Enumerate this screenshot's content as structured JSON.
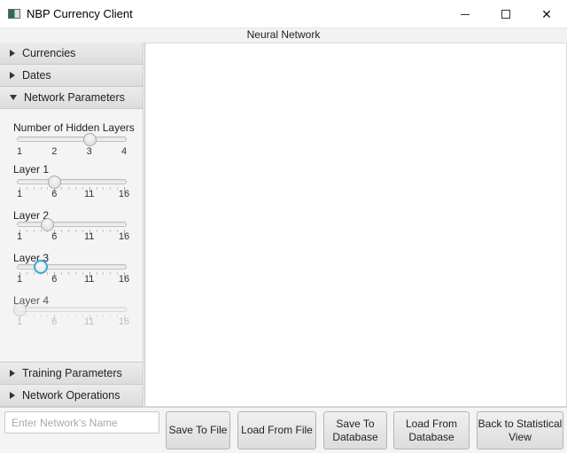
{
  "window": {
    "title": "NBP Currency Client",
    "controls": [
      "minimize",
      "maximize",
      "close"
    ]
  },
  "header": {
    "title": "Neural Network"
  },
  "sidebar": {
    "sections": [
      {
        "label": "Currencies",
        "expanded": false
      },
      {
        "label": "Dates",
        "expanded": false
      },
      {
        "label": "Network Parameters",
        "expanded": true
      },
      {
        "label": "Training Parameters",
        "expanded": false
      },
      {
        "label": "Network Operations",
        "expanded": false
      }
    ],
    "network_parameters": {
      "hidden_layers": {
        "label": "Number of Hidden Layers",
        "min": 1,
        "max": 4,
        "value": 3,
        "tick_labels": [
          "1",
          "2",
          "3",
          "4"
        ]
      },
      "layers": [
        {
          "label": "Layer 1",
          "min": 1,
          "max": 16,
          "value": 6,
          "enabled": true,
          "focused": false,
          "tick_labels": [
            "1",
            "6",
            "11",
            "16"
          ]
        },
        {
          "label": "Layer 2",
          "min": 1,
          "max": 16,
          "value": 5,
          "enabled": true,
          "focused": false,
          "tick_labels": [
            "1",
            "6",
            "11",
            "16"
          ]
        },
        {
          "label": "Layer 3",
          "min": 1,
          "max": 16,
          "value": 4,
          "enabled": true,
          "focused": true,
          "tick_labels": [
            "1",
            "6",
            "11",
            "16"
          ]
        },
        {
          "label": "Layer 4",
          "min": 1,
          "max": 16,
          "value": 1,
          "enabled": false,
          "focused": false,
          "tick_labels": [
            "1",
            "6",
            "11",
            "16"
          ]
        }
      ]
    }
  },
  "bottom": {
    "name_input": {
      "value": "",
      "placeholder": "Enter Network's Name"
    },
    "buttons": [
      {
        "label": "Save To File"
      },
      {
        "label": "Load From File"
      },
      {
        "label": "Save To Database"
      },
      {
        "label": "Load From Database"
      },
      {
        "label": "Back to Statistical View"
      }
    ]
  }
}
